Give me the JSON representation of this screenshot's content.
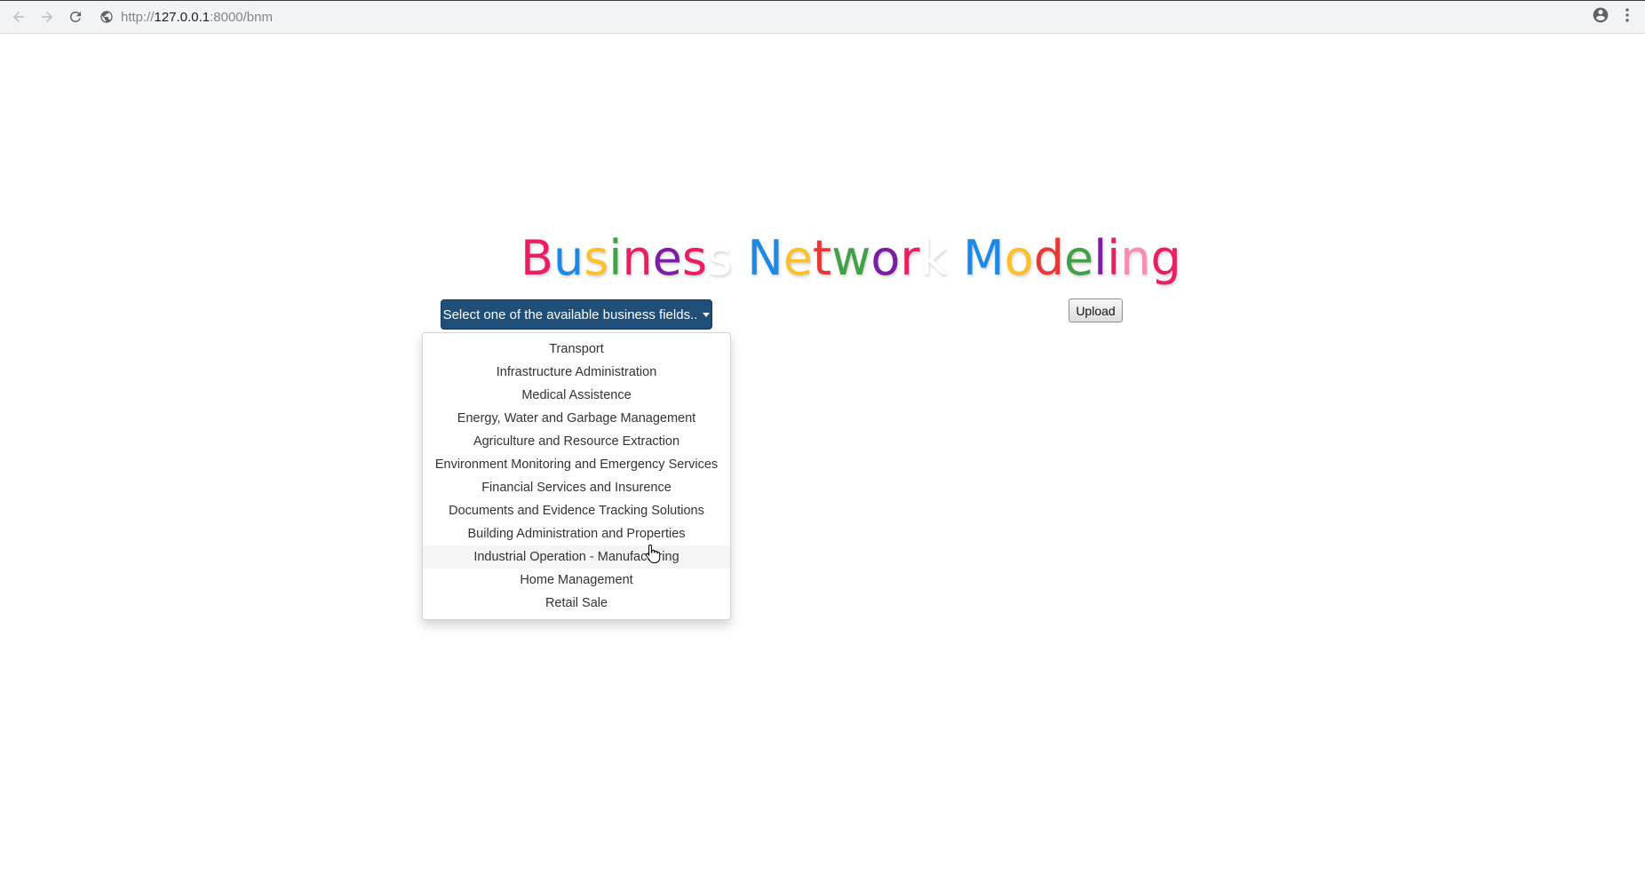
{
  "browser": {
    "url_scheme": "http://",
    "url_host": "127.0.0.1",
    "url_rest": ":8000/bnm"
  },
  "icons": {
    "back": "back-arrow-icon",
    "forward": "forward-arrow-icon",
    "reload": "reload-icon",
    "site_info": "globe-icon",
    "account": "account-icon",
    "menu": "kebab-menu-icon"
  },
  "page": {
    "title": "Business Network Modeling",
    "title_colors": [
      "#e91e63",
      "#1e88e5",
      "#fbc02d",
      "#43a047",
      "#e91e63",
      "#7b1fa2",
      "#e91e63",
      "#ffffff",
      "#e91e63",
      "#1e88e5",
      "#fbc02d",
      "#e53935",
      "#43a047",
      "#7b1fa2",
      "#e91e63",
      "#ffffff",
      "#e91e63",
      "#1e88e5",
      "#fbc02d",
      "#e53935",
      "#43a047",
      "#7b1fa2",
      "#e91e63",
      "#f48fb1"
    ],
    "dropdown_label": "Select one of the available business fields..",
    "upload_label": "Upload",
    "accent_color": "#1f4e79"
  },
  "dropdown": {
    "items": [
      {
        "label": "Transport"
      },
      {
        "label": "Infrastructure Administration"
      },
      {
        "label": "Medical Assistence"
      },
      {
        "label": "Energy, Water and Garbage Management"
      },
      {
        "label": "Agriculture and Resource Extraction"
      },
      {
        "label": "Environment Monitoring and Emergency Services"
      },
      {
        "label": "Financial Services and Insurence"
      },
      {
        "label": "Documents and Evidence Tracking Solutions"
      },
      {
        "label": "Building Administration and Properties"
      },
      {
        "label": "Industrial Operation - Manufacturing"
      },
      {
        "label": "Home Management"
      },
      {
        "label": "Retail Sale"
      }
    ],
    "hovered_index": 9
  }
}
